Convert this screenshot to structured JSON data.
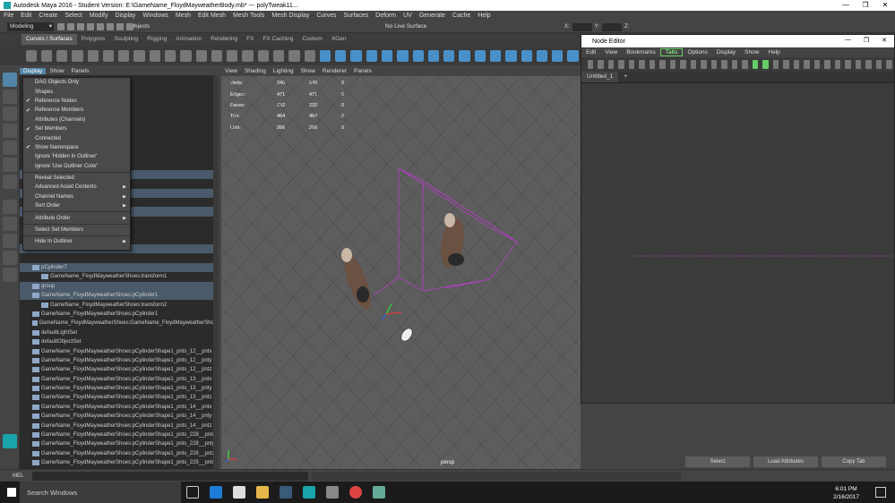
{
  "window": {
    "title": "Autodesk Maya 2016 - Student Version: E:\\GameName_FloydMayweatherBody.mb*  ---  polyTweak11...",
    "controls": [
      "—",
      "❐",
      "✕"
    ]
  },
  "menubar": [
    "File",
    "Edit",
    "Create",
    "Select",
    "Modify",
    "Display",
    "Windows",
    "Mesh",
    "Edit Mesh",
    "Mesh Tools",
    "Mesh Display",
    "Curves",
    "Surfaces",
    "Deform",
    "UV",
    "Generate",
    "Cache",
    "Help"
  ],
  "statusline": {
    "mode": "Modeling",
    "selection_mode": "Objects",
    "live_surface": "No Live Surface",
    "x_label": "X:",
    "y_label": "Y:",
    "z_label": "Z:"
  },
  "shelf_tabs": [
    {
      "label": "Curves / Surfaces",
      "active": true
    },
    {
      "label": "Polygons",
      "active": false
    },
    {
      "label": "Sculpting",
      "active": false
    },
    {
      "label": "Rigging",
      "active": false
    },
    {
      "label": "Animation",
      "active": false
    },
    {
      "label": "Rendering",
      "active": false
    },
    {
      "label": "FX",
      "active": false
    },
    {
      "label": "FX Caching",
      "active": false
    },
    {
      "label": "Custom",
      "active": false
    },
    {
      "label": "XGen",
      "active": false
    }
  ],
  "outliner": {
    "menu": [
      "Display",
      "Show",
      "Panels"
    ],
    "rows": [
      {
        "label": "",
        "hl": false
      },
      {
        "label": "",
        "hl": false
      },
      {
        "label": "",
        "hl": false
      },
      {
        "label": "",
        "hl": false
      },
      {
        "label": "",
        "hl": false
      },
      {
        "label": "",
        "hl": false
      },
      {
        "label": "",
        "hl": false
      },
      {
        "label": "",
        "hl": false
      },
      {
        "label": "",
        "hl": false
      },
      {
        "label": "",
        "hl": false
      },
      {
        "label": "",
        "hl": true
      },
      {
        "label": "",
        "hl": false
      },
      {
        "label": "",
        "hl": true
      },
      {
        "label": "",
        "hl": false
      },
      {
        "label": "",
        "hl": true
      },
      {
        "label": "",
        "hl": false
      },
      {
        "label": "",
        "hl": false
      },
      {
        "label": "",
        "hl": false
      },
      {
        "label": "",
        "hl": true
      },
      {
        "label": "",
        "hl": false
      },
      {
        "label": "pCylinder7",
        "hl": true
      },
      {
        "label": "GameName_FloydMayweatherShoes:transform1",
        "hl": false
      },
      {
        "label": "group",
        "hl": true
      },
      {
        "label": "GameName_FloydMayweatherShoes:pCylinder1",
        "hl": true
      },
      {
        "label": "GameName_FloydMayweatherShoes:transform2",
        "hl": false
      },
      {
        "label": "GameName_FloydMayweatherShoes:pCylinder1",
        "hl": false
      },
      {
        "label": "GameName_FloydMayweatherShoes:GameName_FloydMayweatherSho...",
        "hl": false
      },
      {
        "label": "defaultLightSet",
        "hl": false
      },
      {
        "label": "defaultObjectSet",
        "hl": false
      },
      {
        "label": "GameName_FloydMayweatherShoes:pCylinderShape1_pnts_12__pntx",
        "hl": false
      },
      {
        "label": "GameName_FloydMayweatherShoes:pCylinderShape1_pnts_12__pnty",
        "hl": false
      },
      {
        "label": "GameName_FloydMayweatherShoes:pCylinderShape1_pnts_12__pntz",
        "hl": false
      },
      {
        "label": "GameName_FloydMayweatherShoes:pCylinderShape1_pnts_13__pntx",
        "hl": false
      },
      {
        "label": "GameName_FloydMayweatherShoes:pCylinderShape1_pnts_13__pnty",
        "hl": false
      },
      {
        "label": "GameName_FloydMayweatherShoes:pCylinderShape1_pnts_13__pntz",
        "hl": false
      },
      {
        "label": "GameName_FloydMayweatherShoes:pCylinderShape1_pnts_14__pntx",
        "hl": false
      },
      {
        "label": "GameName_FloydMayweatherShoes:pCylinderShape1_pnts_14__pnty",
        "hl": false
      },
      {
        "label": "GameName_FloydMayweatherShoes:pCylinderShape1_pnts_14__pntz",
        "hl": false
      },
      {
        "label": "GameName_FloydMayweatherShoes:pCylinderShape1_pnts_228__pntx",
        "hl": false
      },
      {
        "label": "GameName_FloydMayweatherShoes:pCylinderShape1_pnts_228__pnty",
        "hl": false
      },
      {
        "label": "GameName_FloydMayweatherShoes:pCylinderShape1_pnts_228__pntz",
        "hl": false
      },
      {
        "label": "GameName_FloydMayweatherShoes:pCylinderShape1_pnts_229__pntx",
        "hl": false
      }
    ]
  },
  "display_menu": [
    {
      "label": "DAG Objects Only",
      "checked": false,
      "sub": false
    },
    {
      "label": "Shapes",
      "checked": false,
      "sub": false
    },
    {
      "label": "Reference Nodes",
      "checked": true,
      "sub": false
    },
    {
      "label": "Reference Members",
      "checked": true,
      "sub": false
    },
    {
      "label": "Attributes (Channels)",
      "checked": false,
      "sub": false
    },
    {
      "label": "Set Members",
      "checked": true,
      "sub": false
    },
    {
      "label": "Connected",
      "checked": false,
      "sub": false
    },
    {
      "label": "Show Namespace",
      "checked": true,
      "sub": false
    },
    {
      "label": "Ignore 'Hidden In Outliner'",
      "checked": false,
      "sub": false
    },
    {
      "label": "Ignore 'Use Outliner Color'",
      "checked": false,
      "sub": false
    },
    {
      "label": "SEP"
    },
    {
      "label": "Reveal Selected",
      "checked": false,
      "sub": false
    },
    {
      "label": "Advanced Asset Contents",
      "checked": false,
      "sub": true
    },
    {
      "label": "Channel Names",
      "checked": false,
      "sub": true
    },
    {
      "label": "Sort Order",
      "checked": false,
      "sub": true
    },
    {
      "label": "SEP"
    },
    {
      "label": "Attribute Order",
      "checked": false,
      "sub": true
    },
    {
      "label": "SEP"
    },
    {
      "label": "Select Set Members",
      "checked": false,
      "sub": false
    },
    {
      "label": "SEP"
    },
    {
      "label": "Hide In Outliner",
      "checked": false,
      "sub": true
    }
  ],
  "viewport": {
    "menu": [
      "View",
      "Shading",
      "Lighting",
      "Show",
      "Renderer",
      "Panels"
    ],
    "hud": [
      {
        "label": "Verts:",
        "a": "240",
        "b": "240",
        "c": "0"
      },
      {
        "label": "Edges:",
        "a": "471",
        "b": "471",
        "c": "0"
      },
      {
        "label": "Faces:",
        "a": "232",
        "b": "232",
        "c": "0"
      },
      {
        "label": "Tris:",
        "a": "464",
        "b": "464",
        "c": "0"
      },
      {
        "label": "UVs:",
        "a": "266",
        "b": "266",
        "c": "0"
      }
    ],
    "camera": "persp"
  },
  "node_editor": {
    "title": "Node Editor",
    "menu": [
      "Edit",
      "View",
      "Bookmarks",
      "Tabs",
      "Options",
      "Display",
      "Show",
      "Help"
    ],
    "tab": "Untitled_1",
    "add_tab": "+"
  },
  "attr_buttons": [
    "Select",
    "Load Attributes",
    "Copy Tab"
  ],
  "mel_label": "MEL",
  "taskbar": {
    "search": "Search Windows",
    "time": "6:01 PM",
    "date": "2/16/2017"
  },
  "colors": {
    "accent": "#5285a6",
    "wire": "#b33fc4",
    "bg_viewport": "#5d5d5d"
  }
}
